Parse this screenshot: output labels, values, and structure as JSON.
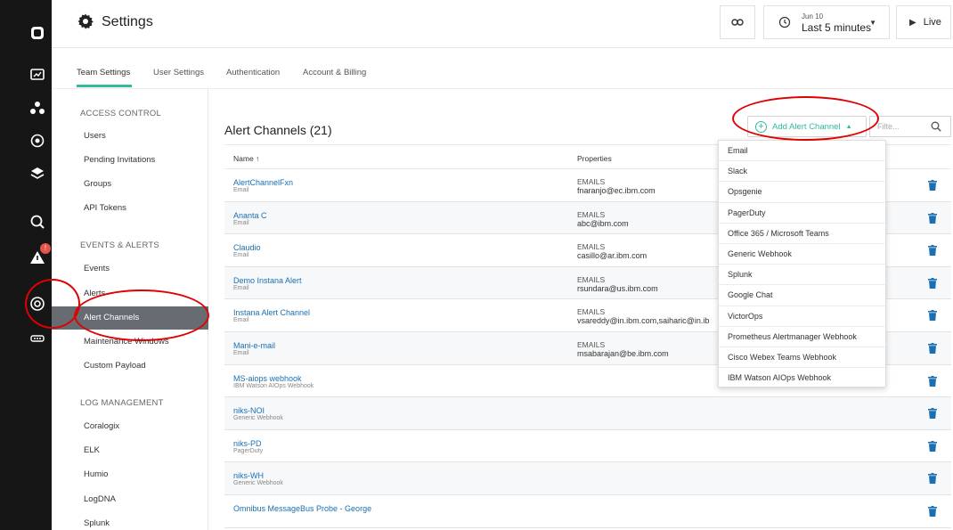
{
  "header": {
    "title": "Settings",
    "time_date": "Jun 10",
    "time_range": "Last 5 minutes",
    "live_label": "Live"
  },
  "tabs": [
    {
      "label": "Team Settings",
      "active": true
    },
    {
      "label": "User Settings"
    },
    {
      "label": "Authentication"
    },
    {
      "label": "Account & Billing"
    }
  ],
  "nav": {
    "access_control": {
      "heading": "ACCESS CONTROL",
      "items": [
        "Users",
        "Pending Invitations",
        "Groups",
        "API Tokens"
      ]
    },
    "events_alerts": {
      "heading": "EVENTS & ALERTS",
      "items": [
        "Events",
        "Alerts",
        "Alert Channels",
        "Maintenance Windows",
        "Custom Payload"
      ],
      "active": "Alert Channels"
    },
    "log_management": {
      "heading": "LOG MANAGEMENT",
      "items": [
        "Coralogix",
        "ELK",
        "Humio",
        "LogDNA",
        "Splunk"
      ]
    }
  },
  "main": {
    "title": "Alert Channels (21)",
    "add_label": "Add Alert Channel",
    "filter_placeholder": "Filte...",
    "col_name": "Name ↑",
    "col_properties": "Properties",
    "rows": [
      {
        "name": "AlertChannelFxn",
        "type": "Email",
        "key": "EMAILS",
        "value": "fnaranjo@ec.ibm.com"
      },
      {
        "name": "Ananta C",
        "type": "Email",
        "key": "EMAILS",
        "value": "abc@ibm.com"
      },
      {
        "name": "Claudio",
        "type": "Email",
        "key": "EMAILS",
        "value": "casillo@ar.ibm.com"
      },
      {
        "name": "Demo Instana Alert",
        "type": "Email",
        "key": "EMAILS",
        "value": "rsundara@us.ibm.com"
      },
      {
        "name": "Instana Alert Channel",
        "type": "Email",
        "key": "EMAILS",
        "value": "vsareddy@in.ibm.com,saiharic@in.ib"
      },
      {
        "name": "Mani-e-mail",
        "type": "Email",
        "key": "EMAILS",
        "value": "msabarajan@be.ibm.com"
      },
      {
        "name": "MS-aiops webhook",
        "type": "IBM Watson AIOps Webhook",
        "key": "",
        "value": ""
      },
      {
        "name": "niks-NOI",
        "type": "Generic Webhook",
        "key": "",
        "value": ""
      },
      {
        "name": "niks-PD",
        "type": "PagerDuty",
        "key": "",
        "value": ""
      },
      {
        "name": "niks-WH",
        "type": "Generic Webhook",
        "key": "",
        "value": ""
      },
      {
        "name": "Omnibus MessageBus Probe - George",
        "type": "",
        "key": "",
        "value": ""
      }
    ]
  },
  "dropdown": [
    "Email",
    "Slack",
    "Opsgenie",
    "PagerDuty",
    "Office 365 / Microsoft Teams",
    "Generic Webhook",
    "Splunk",
    "Google Chat",
    "VictorOps",
    "Prometheus Alertmanager Webhook",
    "Cisco Webex Teams Webhook",
    "IBM Watson AIOps Webhook"
  ],
  "colors": {
    "accent": "#2ebb9e",
    "link": "#1a6fb3",
    "annotation": "#e10000",
    "rail": "#161616"
  }
}
